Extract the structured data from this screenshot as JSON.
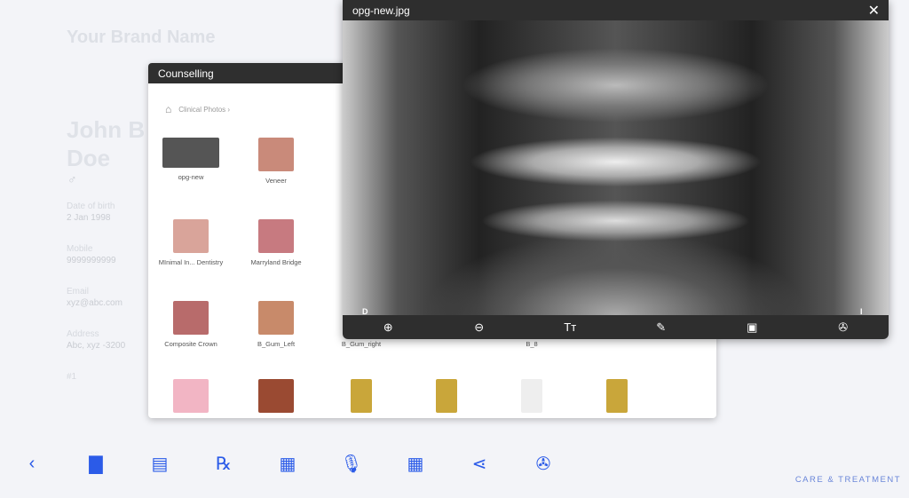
{
  "brand": "Your Brand Name",
  "patient": {
    "name": "John B Doe",
    "gender_symbol": "♂",
    "fields": [
      {
        "label": "Date of birth",
        "value": "2 Jan 1998"
      },
      {
        "label": "Mobile",
        "value": "9999999999"
      },
      {
        "label": "Email",
        "value": "xyz@abc.com"
      },
      {
        "label": "Address",
        "value": "Abc, xyz -3200"
      }
    ],
    "number": "#1"
  },
  "counselling": {
    "title": "Counselling",
    "breadcrumb": "Clinical Photos ›",
    "items": [
      {
        "label": "opg-new",
        "color": "#555"
      },
      {
        "label": "Veneer",
        "color": "#c98a7a"
      },
      {
        "label": "",
        "color": "#333"
      },
      {
        "label": "MInimal In... Dentistry",
        "color": "#d9a49a"
      },
      {
        "label": "Marryland Bridge",
        "color": "#c77a80"
      },
      {
        "label": "",
        "color": "#444"
      },
      {
        "label": "Composite Crown",
        "color": "#b86b6b"
      },
      {
        "label": "B_Gum_Left",
        "color": "#c88a6a"
      },
      {
        "label": "B_Gum_right",
        "color": "#c88a6a"
      },
      {
        "label": "",
        "color": "#ddd"
      },
      {
        "label": "B_8",
        "color": "#eee"
      },
      {
        "label": "",
        "color": "#f2b5c4"
      },
      {
        "label": "",
        "color": "#9a4a32"
      },
      {
        "label": "",
        "color": "#c9a63a"
      },
      {
        "label": "",
        "color": "#c9a63a"
      },
      {
        "label": "",
        "color": "#eeeeee"
      },
      {
        "label": "",
        "color": "#c9a63a"
      }
    ]
  },
  "viewer": {
    "title": "opg-new.jpg",
    "close": "✕",
    "marker_left": "D",
    "marker_right": "I",
    "tools": [
      {
        "name": "zoom-in-icon",
        "glyph": "⊕"
      },
      {
        "name": "zoom-out-icon",
        "glyph": "⊖"
      },
      {
        "name": "text-size-icon",
        "glyph": "Tт"
      },
      {
        "name": "pencil-icon",
        "glyph": "✎"
      },
      {
        "name": "picture-in-picture-icon",
        "glyph": "▣"
      },
      {
        "name": "camera-shutter-icon",
        "glyph": "✇"
      }
    ]
  },
  "bottom_bar": [
    {
      "name": "back-chevron-icon",
      "glyph": "‹"
    },
    {
      "name": "contact-folder-icon",
      "glyph": "▇"
    },
    {
      "name": "folder-icon",
      "glyph": "▤"
    },
    {
      "name": "prescription-icon",
      "glyph": "℞"
    },
    {
      "name": "note-add-icon",
      "glyph": "▦"
    },
    {
      "name": "microphone-icon",
      "glyph": "🎙"
    },
    {
      "name": "calculator-icon",
      "glyph": "▦"
    },
    {
      "name": "share-icon",
      "glyph": "⋖"
    },
    {
      "name": "camera-shutter-icon",
      "glyph": "✇"
    }
  ],
  "footer": "CARE & TREATMENT",
  "colors": {
    "accent": "#2b5be8",
    "header": "#2f2f2f"
  }
}
